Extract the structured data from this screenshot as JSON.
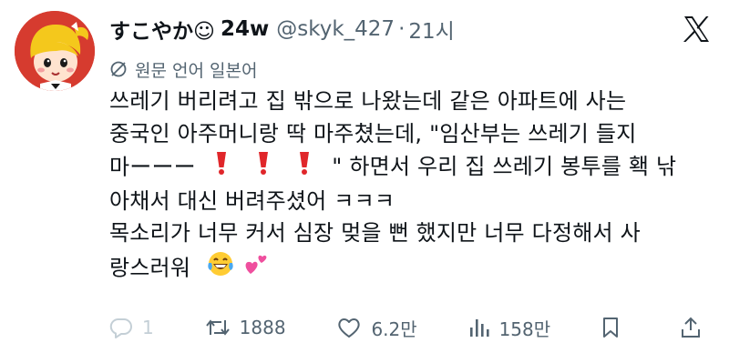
{
  "author": {
    "display_name": "すこやか☺",
    "verified_suffix": "24w",
    "handle": "@skyk_427",
    "separator": "·",
    "time": "21시"
  },
  "translate": {
    "label": "원문 언어 일본어",
    "icon": "translate-icon"
  },
  "tweet": {
    "lines": [
      "쓰레기 버리려고 집 밖으로 나왔는데 같은 아파트에 사는",
      "중국인 아주머니랑 딱 마주쳤는데, \"임산부는 쓰레기 들지",
      "마ーーー",
      "\" 하면서 우리 집 쓰레기 봉투를 홱 낚",
      "아채서 대신 버려주셨어 ㅋㅋㅋ",
      "목소리가 너무 커서 심장 멎을 뻔 했지만 너무 다정해서 사",
      "랑스러워"
    ],
    "emojis": [
      "exclamation-emoji",
      "exclamation-emoji",
      "exclamation-emoji",
      "laughing-tears-emoji",
      "two-hearts-emoji"
    ]
  },
  "actions": {
    "reply_count": "1",
    "repost_count": "1888",
    "like_count": "6.2만",
    "view_count": "158만"
  },
  "colors": {
    "text": "#0f1419",
    "muted": "#536471",
    "avatar_bg": "#d63b2f",
    "emoji_red": "#e0262a"
  }
}
